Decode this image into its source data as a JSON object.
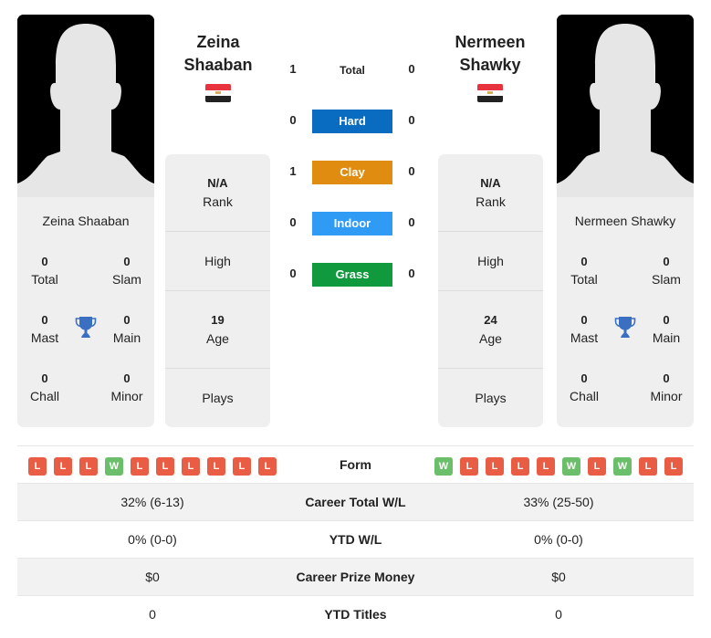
{
  "colors": {
    "hard": "#0a6cc1",
    "clay": "#e08c10",
    "indoor": "#2f9bf4",
    "grass": "#119a3d",
    "loss": "#ea5d45",
    "win": "#6cbf6a",
    "trophy": "#3a6fc2"
  },
  "players": {
    "left": {
      "name_line1": "Zeina",
      "name_line2": "Shaaban",
      "full_name": "Zeina Shaaban",
      "flag": "egypt-flag",
      "titles": {
        "total": "0",
        "slam": "0",
        "mast": "0",
        "main": "0",
        "chall": "0",
        "minor": "0"
      },
      "rank": "N/A",
      "high": "",
      "age": "19",
      "plays": ""
    },
    "right": {
      "name_line1": "Nermeen",
      "name_line2": "Shawky",
      "full_name": "Nermeen Shawky",
      "flag": "egypt-flag",
      "titles": {
        "total": "0",
        "slam": "0",
        "mast": "0",
        "main": "0",
        "chall": "0",
        "minor": "0"
      },
      "rank": "N/A",
      "high": "",
      "age": "24",
      "plays": ""
    }
  },
  "labels": {
    "total": "Total",
    "slam": "Slam",
    "mast": "Mast",
    "main": "Main",
    "chall": "Chall",
    "minor": "Minor",
    "rank": "Rank",
    "high": "High",
    "age": "Age",
    "plays": "Plays"
  },
  "h2h": [
    {
      "label": "Total",
      "left": "1",
      "right": "0"
    },
    {
      "label": "Hard",
      "left": "0",
      "right": "0"
    },
    {
      "label": "Clay",
      "left": "1",
      "right": "0"
    },
    {
      "label": "Indoor",
      "left": "0",
      "right": "0"
    },
    {
      "label": "Grass",
      "left": "0",
      "right": "0"
    }
  ],
  "comparison": {
    "form_label": "Form",
    "left_form": [
      "L",
      "L",
      "L",
      "W",
      "L",
      "L",
      "L",
      "L",
      "L",
      "L"
    ],
    "right_form": [
      "W",
      "L",
      "L",
      "L",
      "L",
      "W",
      "L",
      "W",
      "L",
      "L"
    ],
    "rows": [
      {
        "label": "Career Total W/L",
        "left": "32% (6-13)",
        "right": "33% (25-50)"
      },
      {
        "label": "YTD W/L",
        "left": "0% (0-0)",
        "right": "0% (0-0)"
      },
      {
        "label": "Career Prize Money",
        "left": "$0",
        "right": "$0"
      },
      {
        "label": "YTD Titles",
        "left": "0",
        "right": "0"
      }
    ]
  }
}
